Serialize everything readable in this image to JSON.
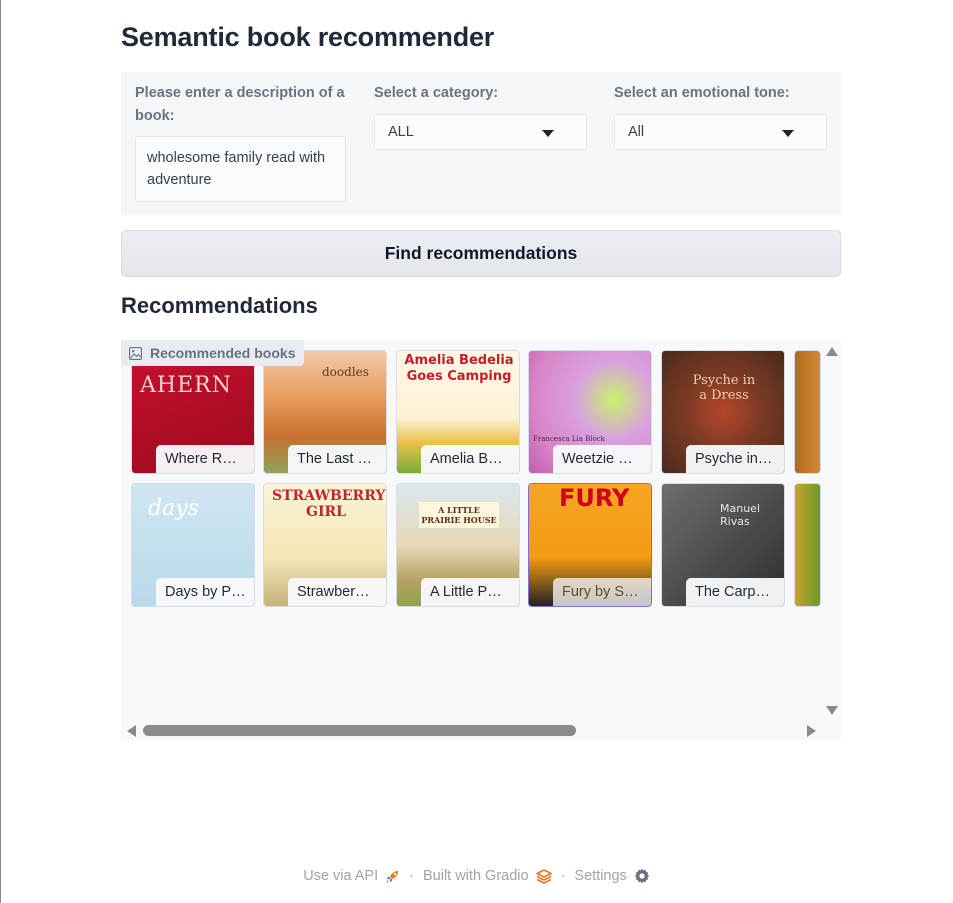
{
  "app": {
    "title": "Semantic book recommender"
  },
  "form": {
    "description_label": "Please enter a description of a book:",
    "description_value": "wholesome family read with adventure",
    "category_label": "Select a category:",
    "category_value": "ALL",
    "tone_label": "Select an emotional tone:",
    "tone_value": "All"
  },
  "actions": {
    "find_label": "Find recommendations"
  },
  "recommendations": {
    "heading": "Recommendations",
    "gallery_label": "Recommended books",
    "row1": [
      {
        "caption": "Where R…",
        "cover_text": "AHERN"
      },
      {
        "caption": "The Last …",
        "cover_text": "doodles"
      },
      {
        "caption": "Amelia B…",
        "cover_text": "Amelia Bedelia Goes Camping"
      },
      {
        "caption": "Weetzie …",
        "cover_text": "Francesca Lia Block"
      },
      {
        "caption": "Psyche in…",
        "cover_text": "Psyche in a Dress"
      }
    ],
    "row2": [
      {
        "caption": "Days by P…",
        "cover_text": "days"
      },
      {
        "caption": "Strawber…",
        "cover_text": "STRAWBERRY GIRL"
      },
      {
        "caption": "A Little P…",
        "cover_text": "A LITTLE PRAIRIE HOUSE"
      },
      {
        "caption": "Fury by S…",
        "cover_text": "FURY"
      },
      {
        "caption": "The Carp…",
        "cover_text": "Manuel Rivas"
      }
    ]
  },
  "footer": {
    "api_label": "Use via API",
    "gradio_label": "Built with Gradio",
    "settings_label": "Settings"
  }
}
